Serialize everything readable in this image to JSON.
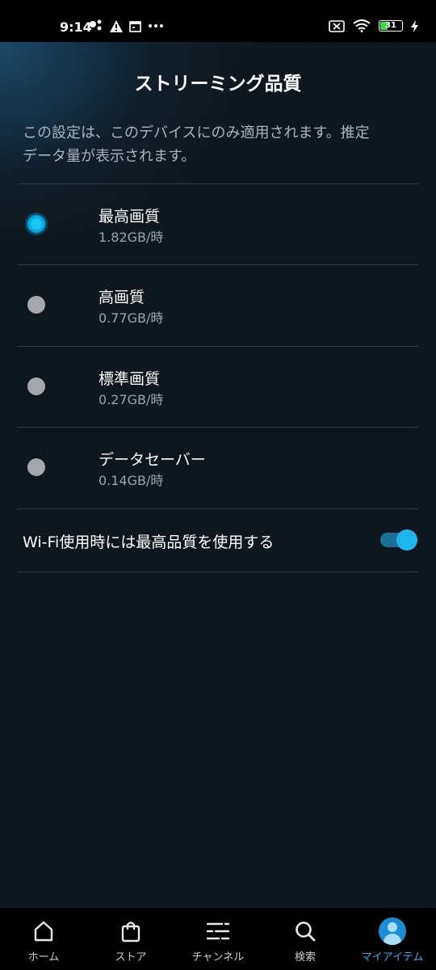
{
  "status_bar": {
    "time": "9:14",
    "battery": "31",
    "icons_left": [
      "assistant-icon",
      "alert-icon",
      "calendar-icon",
      "more-icon"
    ],
    "icons_right": [
      "notification-muted-icon",
      "wifi-icon",
      "battery-icon",
      "charging-icon"
    ]
  },
  "header": {
    "title": "ストリーミング品質"
  },
  "description": {
    "line1": "この設定は、このデバイスにのみ適用されます。推定",
    "line2": "データ量が表示されます。"
  },
  "options": [
    {
      "label": "最高画質",
      "sub": "1.82GB/時",
      "selected": true
    },
    {
      "label": "高画質",
      "sub": "0.77GB/時",
      "selected": false
    },
    {
      "label": "標準画質",
      "sub": "0.27GB/時",
      "selected": false
    },
    {
      "label": "データセーバー",
      "sub": "0.14GB/時",
      "selected": false
    }
  ],
  "wifi_setting": {
    "label": "Wi-Fi使用時には最高品質を使用する",
    "enabled": true
  },
  "bottom_nav": {
    "items": [
      {
        "label": "ホーム",
        "icon": "home-icon",
        "active": false
      },
      {
        "label": "ストア",
        "icon": "shopping-bag-icon",
        "active": false
      },
      {
        "label": "チャンネル",
        "icon": "channels-icon",
        "active": false
      },
      {
        "label": "検索",
        "icon": "search-icon",
        "active": false
      },
      {
        "label": "マイアイテム",
        "icon": "avatar-icon",
        "active": true
      }
    ]
  },
  "colors": {
    "accent": "#00a8e1",
    "background": "#0f171e",
    "nav_active": "#3aa7e4"
  }
}
